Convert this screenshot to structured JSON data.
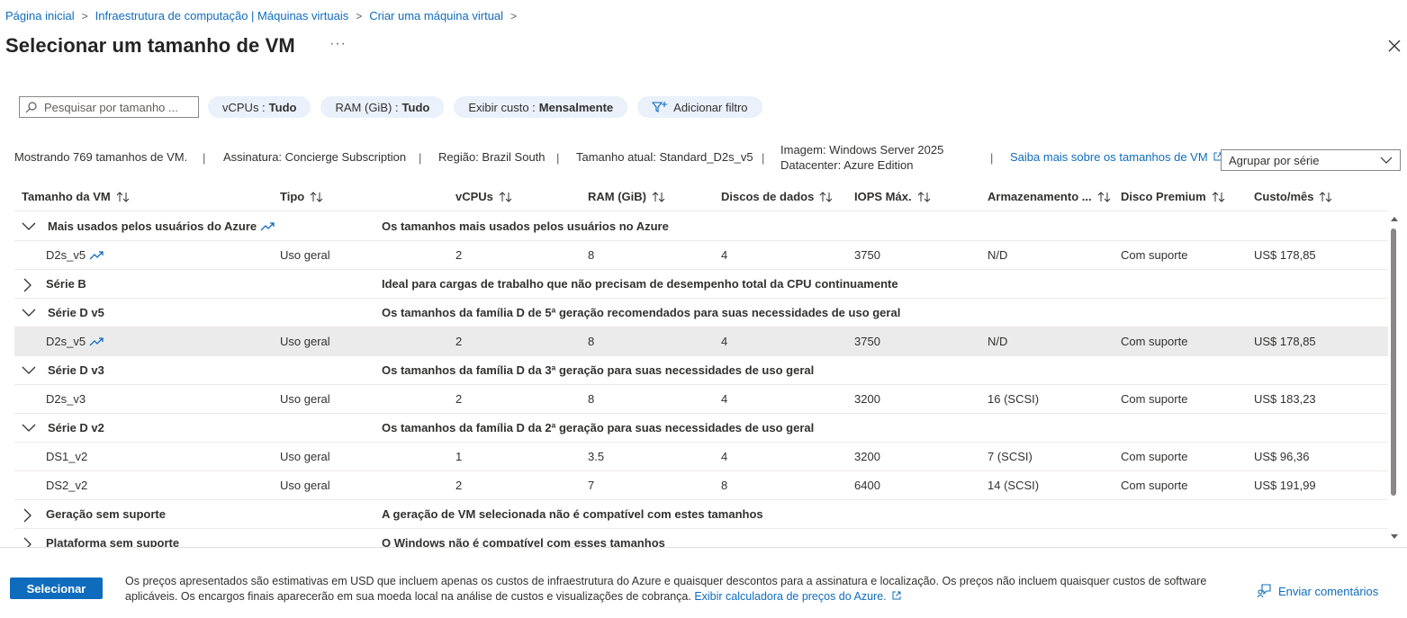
{
  "breadcrumb": [
    "Página inicial",
    "Infraestrutura de computação | Máquinas virtuais",
    "Criar uma máquina virtual"
  ],
  "title": "Selecionar um tamanho de VM",
  "more": "···",
  "search": {
    "placeholder": "Pesquisar por tamanho ..."
  },
  "filters": {
    "vcpus": {
      "label": "vCPUs :",
      "value": "Tudo"
    },
    "ram": {
      "label": "RAM (GiB) :",
      "value": "Tudo"
    },
    "cost": {
      "label": "Exibir custo :",
      "value": "Mensalmente"
    },
    "add": "Adicionar filtro"
  },
  "info": {
    "showing": "Mostrando 769 tamanhos de VM.",
    "subscription": "Assinatura: Concierge Subscription",
    "region": "Região: Brazil South",
    "current_size": "Tamanho atual: Standard_D2s_v5",
    "image_line1": "Imagem: Windows Server 2025",
    "image_line2": "Datacenter: Azure Edition",
    "learn_more": "Saiba mais sobre os tamanhos de VM",
    "group_by": "Agrupar por série"
  },
  "columns": [
    "Tamanho da VM",
    "Tipo",
    "vCPUs",
    "RAM (GiB)",
    "Discos de dados",
    "IOPS Máx.",
    "Armazenamento ...",
    "Disco Premium",
    "Custo/mês"
  ],
  "rows": [
    {
      "kind": "group",
      "expanded": true,
      "name": "Mais usados pelos usuários do Azure",
      "trend": true,
      "desc": "Os tamanhos mais usados pelos usuários no Azure"
    },
    {
      "kind": "item",
      "trend": true,
      "selected": false,
      "cells": [
        "D2s_v5",
        "Uso geral",
        "2",
        "8",
        "4",
        "3750",
        "N/D",
        "Com suporte",
        "US$ 178,85"
      ]
    },
    {
      "kind": "group",
      "expanded": false,
      "name": "Série B",
      "trend": false,
      "desc": "Ideal para cargas de trabalho que não precisam de desempenho total da CPU continuamente"
    },
    {
      "kind": "group",
      "expanded": true,
      "name": "Série D v5",
      "trend": false,
      "desc": "Os tamanhos da família D de 5ª geração recomendados para suas necessidades de uso geral"
    },
    {
      "kind": "item",
      "trend": true,
      "selected": true,
      "cells": [
        "D2s_v5",
        "Uso geral",
        "2",
        "8",
        "4",
        "3750",
        "N/D",
        "Com suporte",
        "US$ 178,85"
      ]
    },
    {
      "kind": "group",
      "expanded": true,
      "name": "Série D v3",
      "trend": false,
      "desc": "Os tamanhos da família D da 3ª geração para suas necessidades de uso geral"
    },
    {
      "kind": "item",
      "trend": false,
      "selected": false,
      "cells": [
        "D2s_v3",
        "Uso geral",
        "2",
        "8",
        "4",
        "3200",
        "16 (SCSI)",
        "Com suporte",
        "US$ 183,23"
      ]
    },
    {
      "kind": "group",
      "expanded": true,
      "name": "Série D v2",
      "trend": false,
      "desc": "Os tamanhos da família D da 2ª geração para suas necessidades de uso geral"
    },
    {
      "kind": "item",
      "trend": false,
      "selected": false,
      "cells": [
        "DS1_v2",
        "Uso geral",
        "1",
        "3.5",
        "4",
        "3200",
        "7 (SCSI)",
        "Com suporte",
        "US$ 96,36"
      ]
    },
    {
      "kind": "item",
      "trend": false,
      "selected": false,
      "cells": [
        "DS2_v2",
        "Uso geral",
        "2",
        "7",
        "8",
        "6400",
        "14 (SCSI)",
        "Com suporte",
        "US$ 191,99"
      ]
    },
    {
      "kind": "group",
      "expanded": false,
      "name": "Geração sem suporte",
      "trend": false,
      "desc": "A geração de VM selecionada não é compatível com estes tamanhos"
    },
    {
      "kind": "group",
      "expanded": false,
      "name": "Plataforma sem suporte",
      "trend": false,
      "desc": "O Windows não é compatível com esses tamanhos"
    }
  ],
  "footer": {
    "select": "Selecionar",
    "note": "Os preços apresentados são estimativas em USD que incluem apenas os custos de infraestrutura do Azure e quaisquer descontos para a assinatura e localização. Os preços não incluem quaisquer custos de software aplicáveis. Os encargos finais aparecerão em sua moeda local na análise de custos e visualizações de cobrança.",
    "calculator": "Exibir calculadora de preços do Azure.",
    "feedback": "Enviar comentários"
  },
  "colors": {
    "accent": "#0f6cbd",
    "pill": "#eaf1fb",
    "selected_row": "#ebebeb"
  }
}
